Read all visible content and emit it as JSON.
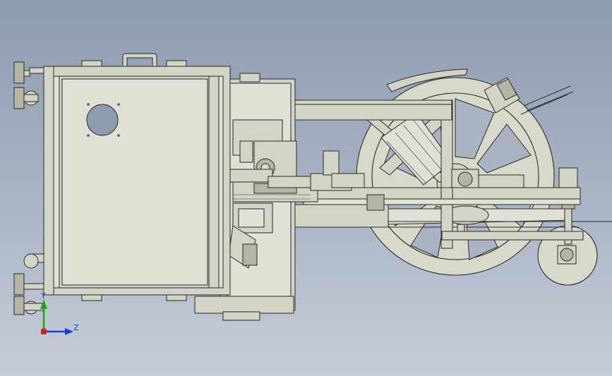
{
  "view": {
    "background_top": "#8e9cb0",
    "background_bottom": "#c6cdd8",
    "part_color": "#d3d3c6"
  },
  "triad": {
    "y_label": "Y",
    "z_label": "Z",
    "y_color": "#1aa51a",
    "z_color": "#1a3fd8",
    "origin_color": "#d81a1a"
  }
}
